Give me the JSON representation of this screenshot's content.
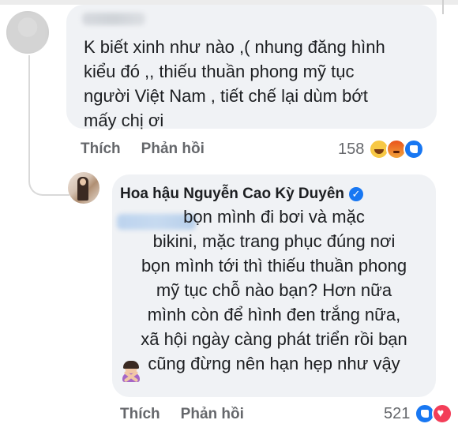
{
  "comment1": {
    "text": "K biết xinh như nào ,( nhung đăng hình\nkiểu đó ,, thiếu thuần phong mỹ tục\nngười Việt Nam , tiết chế lại dùm bớt\nmấy chị ơi",
    "actions": {
      "like_label": "Thích",
      "reply_label": "Phản hồi"
    },
    "reactions": {
      "count": "158",
      "icons": [
        "haha-icon",
        "angry-icon",
        "like-icon"
      ]
    }
  },
  "reply": {
    "author": "Hoa hậu Nguyễn Cao Kỳ Duyên",
    "verified_mark": "✓",
    "text": "bọn mình đi bơi và mặc\nbikini, mặc trang phục đúng nơi\nbọn mình tới thì thiếu thuần phong\nmỹ tục chỗ nào bạn? Hơn nữa\nmình còn để hình đen trắng nữa,\nxã hội ngày càng phát triển rồi bạn\ncũng đừng nên hạn hẹp như vậy",
    "emoji": "woman-gesturing-no-icon",
    "actions": {
      "like_label": "Thích",
      "reply_label": "Phản hồi"
    },
    "reactions": {
      "count": "521",
      "icons": [
        "like-icon",
        "love-icon"
      ]
    }
  },
  "colors": {
    "bubble": "#f0f2f5",
    "action_text": "#65676b",
    "like": "#1877f2",
    "love": "#f33e58"
  }
}
